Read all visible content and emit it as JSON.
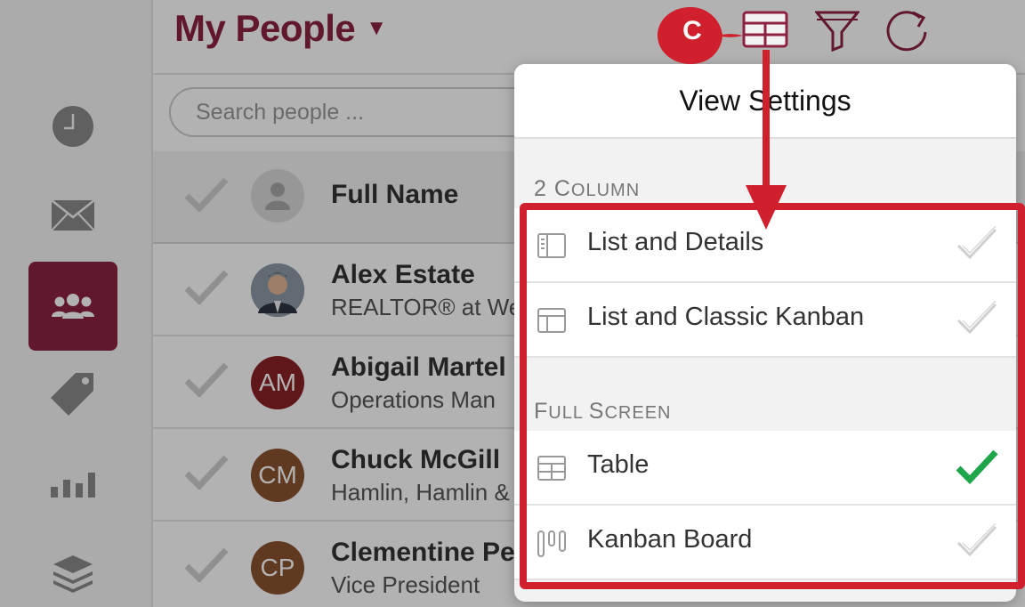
{
  "header": {
    "title": "My People",
    "caret": "▼",
    "view_icon": "table-view-icon",
    "filter_icon": "filter-icon",
    "refresh_icon": "refresh-icon"
  },
  "sidebar": {
    "items": [
      {
        "icon": "clock-icon",
        "active": false
      },
      {
        "icon": "mail-icon",
        "active": false
      },
      {
        "icon": "people-icon",
        "active": true
      },
      {
        "icon": "tag-icon",
        "active": false
      },
      {
        "icon": "bar-chart-icon",
        "active": false
      },
      {
        "icon": "layers-icon",
        "active": false
      }
    ]
  },
  "search": {
    "placeholder": "Search people ..."
  },
  "list": {
    "header_label": "Full Name",
    "rows": [
      {
        "name": "Alex Estate",
        "subtitle": "REALTOR® at We",
        "initials": "",
        "avatar_color": "#5a6b7a"
      },
      {
        "name": "Abigail Martel",
        "subtitle": "Operations Man",
        "initials": "AM",
        "avatar_color": "#8a2224"
      },
      {
        "name": "Chuck McGill",
        "subtitle": "Hamlin, Hamlin &",
        "initials": "CM",
        "avatar_color": "#8a5230"
      },
      {
        "name": "Clementine Pe",
        "subtitle": "Vice President",
        "initials": "CP",
        "avatar_color": "#8a5230"
      }
    ]
  },
  "popover": {
    "title": "View Settings",
    "sections": [
      {
        "heading_first": "2 C",
        "heading_rest": "OLUMN",
        "options": [
          {
            "label": "List and Details",
            "icon": "list-details-icon",
            "selected": false
          },
          {
            "label": "List and Classic Kanban",
            "icon": "list-kanban-icon",
            "selected": false
          }
        ]
      },
      {
        "heading_first": "F",
        "heading_rest": "ULL ",
        "heading_first2": "S",
        "heading_rest2": "CREEN",
        "options": [
          {
            "label": "Table",
            "icon": "table-icon",
            "selected": true
          },
          {
            "label": "Kanban Board",
            "icon": "kanban-board-icon",
            "selected": false
          }
        ]
      }
    ]
  },
  "annotation": {
    "callout_label": "C",
    "color": "#d0202e"
  },
  "colors": {
    "brand": "#8c2240",
    "check_selected": "#1fa64a"
  }
}
